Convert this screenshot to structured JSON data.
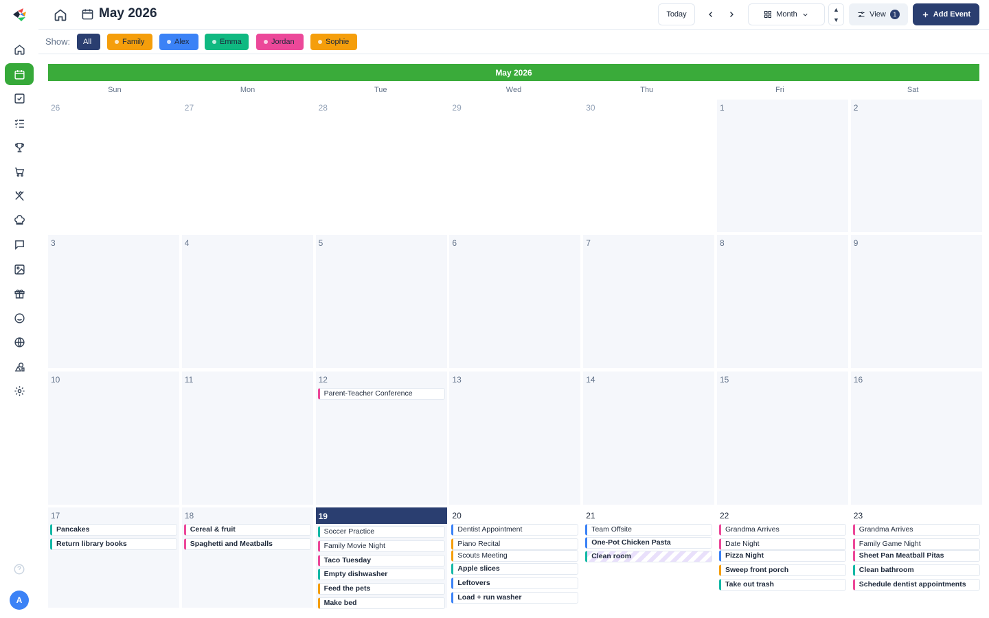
{
  "app": {
    "avatar_initial": "A"
  },
  "header": {
    "title": "May 2026",
    "today_label": "Today",
    "view_mode_label": "Month",
    "view_label": "View",
    "view_badge": "1",
    "add_event_label": "Add Event"
  },
  "filters": {
    "show_label": "Show:",
    "chips": [
      {
        "label": "All",
        "color": "#2a3e70"
      },
      {
        "label": "Family",
        "color": "#f59e0b"
      },
      {
        "label": "Alex",
        "color": "#3b82f6"
      },
      {
        "label": "Emma",
        "color": "#10b981"
      },
      {
        "label": "Jordan",
        "color": "#ec4899"
      },
      {
        "label": "Sophie",
        "color": "#f59e0b"
      }
    ]
  },
  "sidebar": {
    "icons": [
      "home-icon",
      "calendar-icon",
      "checkbox-icon",
      "list-checks-icon",
      "trophy-icon",
      "cart-icon",
      "utensils-icon",
      "chef-hat-icon",
      "message-icon",
      "image-icon",
      "gift-icon",
      "smile-icon",
      "globe-icon",
      "shapes-icon",
      "gear-icon"
    ]
  },
  "calendar": {
    "month_header": "May 2026",
    "weekdays": [
      "Sun",
      "Mon",
      "Tue",
      "Wed",
      "Thu",
      "Fri",
      "Sat"
    ],
    "weeks": [
      [
        {
          "day": "26",
          "out": true
        },
        {
          "day": "27",
          "out": true
        },
        {
          "day": "28",
          "out": true
        },
        {
          "day": "29",
          "out": true
        },
        {
          "day": "30",
          "out": true
        },
        {
          "day": "1"
        },
        {
          "day": "2"
        }
      ],
      [
        {
          "day": "3"
        },
        {
          "day": "4"
        },
        {
          "day": "5"
        },
        {
          "day": "6"
        },
        {
          "day": "7"
        },
        {
          "day": "8"
        },
        {
          "day": "9"
        }
      ],
      [
        {
          "day": "10"
        },
        {
          "day": "11"
        },
        {
          "day": "12",
          "events": [
            {
              "title": "Parent-Teacher Conference",
              "color": "#ec4899"
            }
          ]
        },
        {
          "day": "13"
        },
        {
          "day": "14"
        },
        {
          "day": "15"
        },
        {
          "day": "16"
        }
      ],
      [
        {
          "day": "17",
          "events": [
            {
              "title": "Pancakes",
              "color": "#14b8a6",
              "bold": true
            },
            {
              "title": "Return library books",
              "color": "#14b8a6",
              "bold": true
            }
          ]
        },
        {
          "day": "18",
          "events": [
            {
              "title": "Cereal & fruit",
              "color": "#ec4899",
              "bold": true
            },
            {
              "title": "Spaghetti and Meatballs",
              "color": "#ec4899",
              "bold": true
            }
          ]
        },
        {
          "day": "19",
          "today": true,
          "events": [
            {
              "title": "Soccer Practice",
              "color": "#14b8a6"
            },
            {
              "title": "Family Movie Night",
              "color": "#ec4899"
            },
            {
              "title": "Taco Tuesday",
              "color": "#ec4899",
              "bold": true
            },
            {
              "title": "Empty dishwasher",
              "color": "#14b8a6",
              "bold": true
            },
            {
              "title": "Feed the pets",
              "color": "#f59e0b",
              "bold": true
            },
            {
              "title": "Make bed",
              "color": "#f59e0b",
              "bold": true
            }
          ]
        },
        {
          "day": "20",
          "events": [
            {
              "title": "Dentist Appointment",
              "color": "#3b82f6"
            },
            {
              "title": "Piano Recital",
              "color": "#f59e0b"
            },
            {
              "title": "Scouts Meeting",
              "color": "#f59e0b"
            },
            {
              "title": "Apple slices",
              "color": "#14b8a6",
              "bold": true
            },
            {
              "title": "Leftovers",
              "color": "#3b82f6",
              "bold": true
            },
            {
              "title": "Load + run washer",
              "color": "#3b82f6",
              "bold": true
            }
          ]
        },
        {
          "day": "21",
          "events": [
            {
              "title": "Team Offsite",
              "color": "#3b82f6"
            },
            {
              "title": "One-Pot Chicken Pasta",
              "color": "#3b82f6",
              "bold": true
            },
            {
              "title": "Clean room",
              "color": "#14b8a6",
              "bold": true,
              "striped": true
            }
          ]
        },
        {
          "day": "22",
          "events": [
            {
              "title": "Grandma Arrives",
              "color": "#ec4899"
            },
            {
              "title": "Date Night",
              "color": "#ec4899"
            },
            {
              "title": "Pizza Night",
              "color": "#3b82f6",
              "bold": true
            },
            {
              "title": "Sweep front porch",
              "color": "#f59e0b",
              "bold": true
            },
            {
              "title": "Take out trash",
              "color": "#14b8a6",
              "bold": true
            }
          ]
        },
        {
          "day": "23",
          "events": [
            {
              "title": "Grandma Arrives",
              "color": "#ec4899"
            },
            {
              "title": "Family Game Night",
              "color": "#ec4899"
            },
            {
              "title": "Sheet Pan Meatball Pitas",
              "color": "#ec4899",
              "bold": true
            },
            {
              "title": "Clean bathroom",
              "color": "#14b8a6",
              "bold": true
            },
            {
              "title": "Schedule dentist appointments",
              "color": "#ec4899",
              "bold": true
            }
          ]
        }
      ]
    ]
  }
}
